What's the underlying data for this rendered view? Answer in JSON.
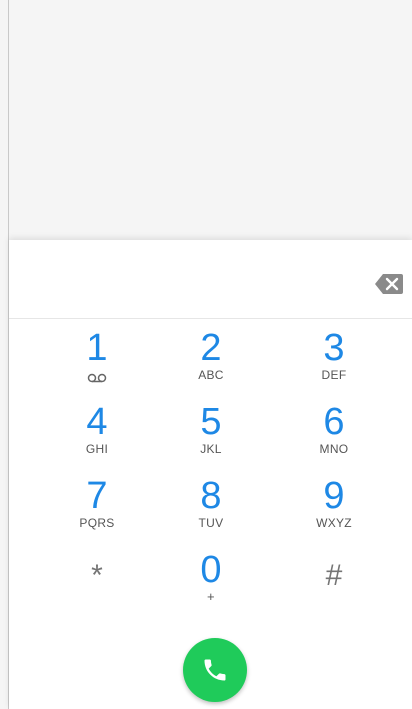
{
  "dialer": {
    "digits_value": "",
    "keys": [
      {
        "digit": "1",
        "letters": ""
      },
      {
        "digit": "2",
        "letters": "ABC"
      },
      {
        "digit": "3",
        "letters": "DEF"
      },
      {
        "digit": "4",
        "letters": "GHI"
      },
      {
        "digit": "5",
        "letters": "JKL"
      },
      {
        "digit": "6",
        "letters": "MNO"
      },
      {
        "digit": "7",
        "letters": "PQRS"
      },
      {
        "digit": "8",
        "letters": "TUV"
      },
      {
        "digit": "9",
        "letters": "WXYZ"
      },
      {
        "digit": "*",
        "letters": ""
      },
      {
        "digit": "0",
        "letters": "+"
      },
      {
        "digit": "#",
        "letters": ""
      }
    ],
    "icons": {
      "backspace": "backspace-icon",
      "voicemail": "voicemail-icon",
      "call": "phone-icon"
    },
    "colors": {
      "digit": "#1e88e5",
      "call_button": "#1fcb5a"
    }
  }
}
